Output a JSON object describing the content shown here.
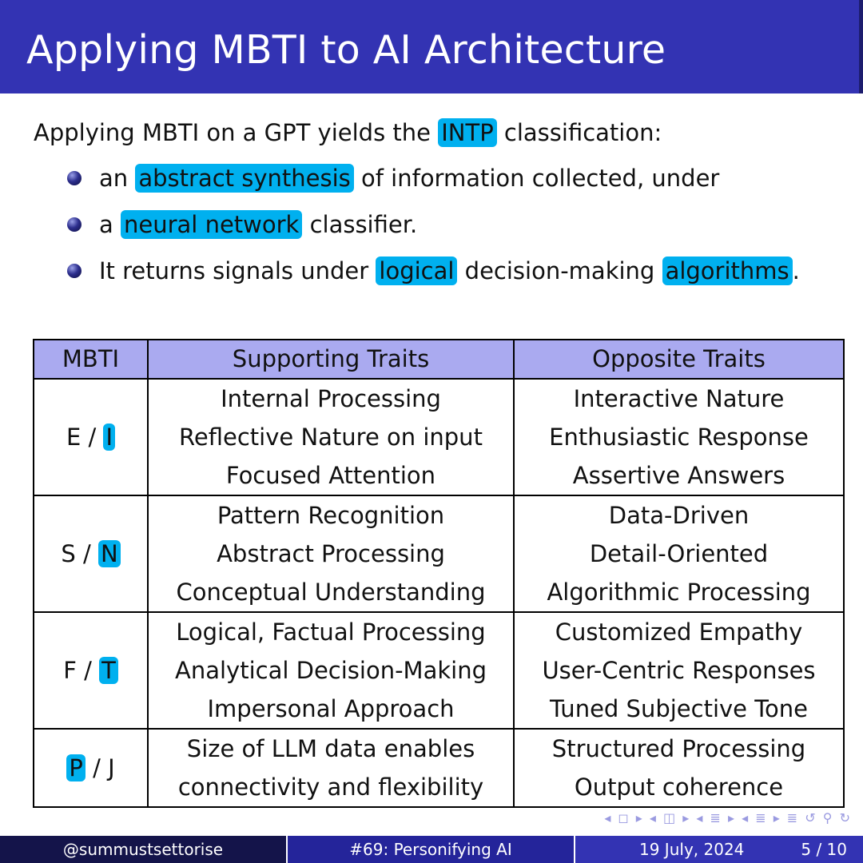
{
  "slide": {
    "title": "Applying MBTI to AI Architecture",
    "intro": {
      "before": "Applying MBTI on a GPT yields the",
      "highlight": "INTP",
      "after": "classification:"
    },
    "bullets": [
      {
        "pre": "an",
        "hl1": "abstract synthesis",
        "mid": "of information collected, under",
        "hl2": "",
        "post": ""
      },
      {
        "pre": "a",
        "hl1": "neural network",
        "mid": "classifier.",
        "hl2": "",
        "post": ""
      },
      {
        "pre": "It returns signals under",
        "hl1": "logical",
        "mid": "decision-making",
        "hl2": "algorithms",
        "post": "."
      }
    ]
  },
  "table": {
    "headers": [
      "MBTI",
      "Supporting Traits",
      "Opposite Traits"
    ],
    "rows": [
      {
        "left": "E /",
        "right": "I",
        "hl": "right",
        "supporting": [
          "Internal Processing",
          "Reflective Nature on input",
          "Focused Attention"
        ],
        "opposite": [
          "Interactive Nature",
          "Enthusiastic Response",
          "Assertive Answers"
        ]
      },
      {
        "left": "S /",
        "right": "N",
        "hl": "right",
        "supporting": [
          "Pattern Recognition",
          "Abstract Processing",
          "Conceptual Understanding"
        ],
        "opposite": [
          "Data-Driven",
          "Detail-Oriented",
          "Algorithmic Processing"
        ]
      },
      {
        "left": "F /",
        "right": "T",
        "hl": "right",
        "supporting": [
          "Logical, Factual Processing",
          "Analytical Decision-Making",
          "Impersonal Approach"
        ],
        "opposite": [
          "Customized Empathy",
          "User-Centric Responses",
          "Tuned Subjective Tone"
        ]
      },
      {
        "left": "P",
        "right": "/ J",
        "hl": "left",
        "supporting": [
          "Size of LLM data enables",
          "connectivity and flexibility"
        ],
        "opposite": [
          "Structured Processing",
          "Output coherence"
        ]
      }
    ]
  },
  "footer": {
    "author": "@summustsettorise",
    "talk": "#69: Personifying AI",
    "date": "19 July, 2024",
    "page": "5 / 10"
  },
  "nav_symbols": "◂ ◻ ▸  ◂ ◫ ▸  ◂ ≣ ▸  ◂ ≣ ▸    ≣    ↺ ⚲ ↻",
  "colors": {
    "title_bar": "#3333b3",
    "highlight": "#00b0ef",
    "table_header": "#aaaaf0",
    "footer_dark": "#14144a",
    "footer_mid": "#24249a",
    "footer_light": "#3333b3"
  }
}
